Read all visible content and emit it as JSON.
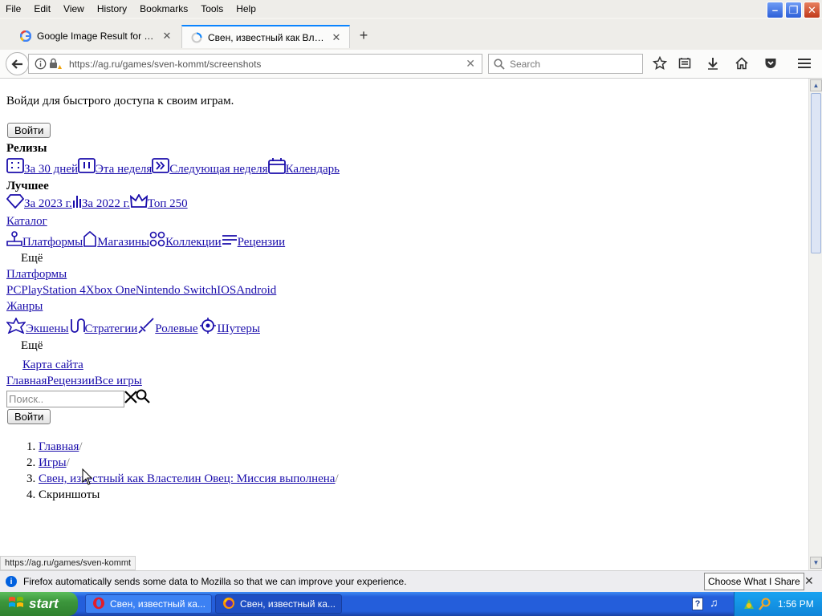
{
  "menubar": {
    "items": [
      "File",
      "Edit",
      "View",
      "History",
      "Bookmarks",
      "Tools",
      "Help"
    ]
  },
  "tabs": [
    {
      "title": "Google Image Result for http...",
      "icon": "google-icon",
      "active": false
    },
    {
      "title": "Свен, известный как Власт...",
      "icon": "loading-icon",
      "active": true
    }
  ],
  "navbar": {
    "url": "https://ag.ru/games/sven-kommt/screenshots",
    "search_placeholder": "Search"
  },
  "page": {
    "login_prompt": "Войди для быстрого доступа к своим играм.",
    "login_button": "Войти",
    "releases_heading": "Релизы",
    "releases_links": [
      "За 30 дней",
      "Эта неделя",
      "Следующая неделя",
      "Календарь"
    ],
    "best_heading": "Лучшее",
    "best_links": [
      "За 2023 г.",
      "За 2022 г.",
      "Топ 250"
    ],
    "catalog_link": "Каталог",
    "catalog_links": [
      "Платформы",
      "Магазины",
      "Коллекции",
      "Рецензии"
    ],
    "more_1": "Ещё",
    "platforms_link": "Платформы",
    "platform_links": [
      "PC",
      "PlayStation 4",
      "Xbox One",
      "Nintendo Switch",
      "IOS",
      "Android"
    ],
    "genres_link": "Жанры",
    "genre_links": [
      "Экшены",
      "Стратегии",
      "Ролевые",
      "Шутеры"
    ],
    "more_2": "Ещё",
    "sitemap_link": "Карта сайта",
    "footer_links": [
      "Главная",
      "Рецензии",
      "Все игры"
    ],
    "search_placeholder": "Поиск..",
    "login_button_2": "Войти",
    "breadcrumbs": [
      {
        "label": "Главная",
        "link": true
      },
      {
        "label": "Игры",
        "link": true
      },
      {
        "label": "Свен, известный как Властелин Овец: Миссия выполнена",
        "link": true
      },
      {
        "label": "Скриншоты",
        "link": false
      }
    ],
    "breadcrumb_separator": "/"
  },
  "status_link": "https://ag.ru/games/sven-kommt",
  "notification": {
    "text": "Firefox automatically sends some data to Mozilla so that we can improve your experience.",
    "button": "Choose What I Share"
  },
  "taskbar": {
    "start_label": "start",
    "tasks": [
      {
        "title": "Свен, известный ка...",
        "icon": "opera-icon"
      },
      {
        "title": "Свен, известный ка...",
        "icon": "firefox-icon"
      }
    ],
    "clock": "1:56 PM"
  },
  "colors": {
    "link": "#1a0dab",
    "tab_accent": "#0a84ff",
    "taskbar": "#245edb",
    "start": "#3c963c"
  }
}
